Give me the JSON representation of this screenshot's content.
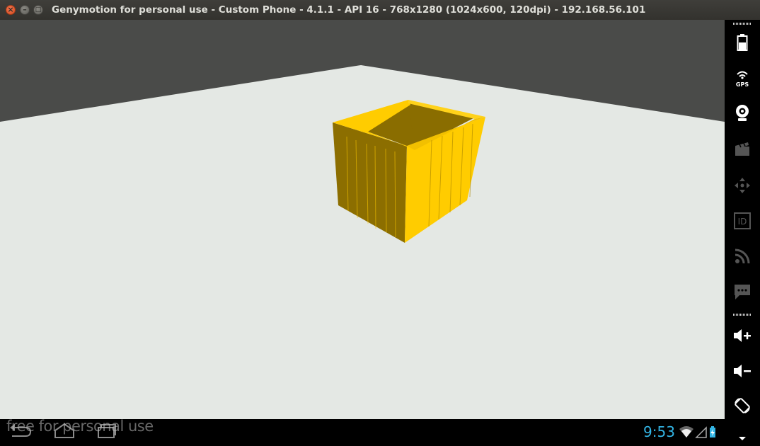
{
  "window": {
    "title": "Genymotion for personal use - Custom Phone - 4.1.1 - API 16 - 768x1280 (1024x600, 120dpi) - 192.168.56.101",
    "close_glyph": "×",
    "minimize_glyph": "–",
    "maximize_glyph": "□"
  },
  "screen": {
    "background_color": "#4a4b49",
    "floor_color": "#e4e8e4",
    "object_colors": {
      "light_face": "#ffcc00",
      "dark_face": "#8c6e00",
      "inner": "#8a6d00"
    }
  },
  "watermark": "free for personal use",
  "navbar": {
    "back_icon": "back-icon",
    "home_icon": "home-icon",
    "recent_icon": "recent-apps-icon",
    "time": "9:53",
    "clock_color": "#33b5e5"
  },
  "sidebar": {
    "items": [
      {
        "name": "battery",
        "icon": "battery-icon"
      },
      {
        "name": "gps",
        "icon": "gps-icon",
        "label": "GPS"
      },
      {
        "name": "camera",
        "icon": "webcam-icon"
      },
      {
        "name": "capture",
        "icon": "clapperboard-icon"
      },
      {
        "name": "remote-control",
        "icon": "dpad-icon"
      },
      {
        "name": "identifiers",
        "icon": "id-icon",
        "label": "ID"
      },
      {
        "name": "network",
        "icon": "rss-icon"
      },
      {
        "name": "sms",
        "icon": "message-icon"
      },
      {
        "name": "volume-up",
        "icon": "volume-up-icon"
      },
      {
        "name": "volume-down",
        "icon": "volume-down-icon"
      },
      {
        "name": "rotate",
        "icon": "rotate-icon"
      },
      {
        "name": "more",
        "icon": "chevron-down-icon"
      }
    ]
  }
}
